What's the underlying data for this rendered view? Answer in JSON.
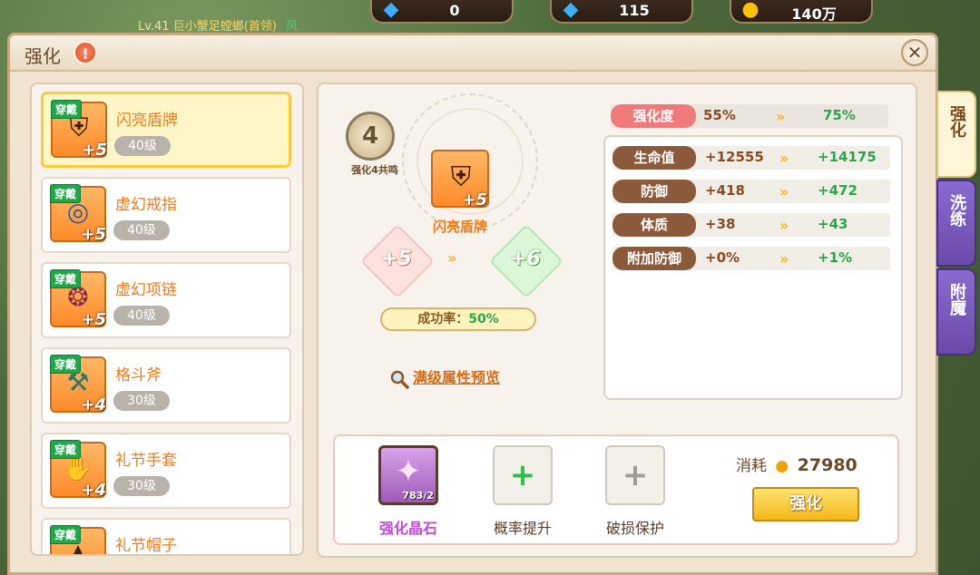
{
  "hud": {
    "level_text": "Lv.41",
    "player_name": "巨小蟹足螳螂(首领)",
    "zone_text": "风",
    "currencies": [
      {
        "icon": "diamond-icon",
        "value": "0"
      },
      {
        "icon": "bound-diamond-icon",
        "value": "115"
      },
      {
        "icon": "gold-icon",
        "value": "140万"
      }
    ]
  },
  "dialog": {
    "title": "强化",
    "help": "!",
    "close": "✕"
  },
  "items": [
    {
      "name": "闪亮盾牌",
      "level": "40级",
      "plus": "+5",
      "badge": "穿戴",
      "icon": "shield-icon",
      "selected": true
    },
    {
      "name": "虚幻戒指",
      "level": "40级",
      "plus": "+5",
      "badge": "穿戴",
      "icon": "ring-icon"
    },
    {
      "name": "虚幻项链",
      "level": "40级",
      "plus": "+5",
      "badge": "穿戴",
      "icon": "necklace-icon"
    },
    {
      "name": "格斗斧",
      "level": "30级",
      "plus": "+4",
      "badge": "穿戴",
      "icon": "axe-icon"
    },
    {
      "name": "礼节手套",
      "level": "30级",
      "plus": "+4",
      "badge": "穿戴",
      "icon": "glove-icon"
    },
    {
      "name": "礼节帽子",
      "level": "",
      "plus": "",
      "badge": "穿戴",
      "icon": "hat-icon"
    }
  ],
  "detail": {
    "medal_num": "4",
    "medal_caption": "强化4共鸣",
    "equip_name": "闪亮盾牌",
    "equip_plus": "+5",
    "current_plus": "+5",
    "next_plus": "+6",
    "arrow_glyph": "»",
    "rate_label": "成功率：",
    "rate_value": "50%",
    "preview_link": "满级属性预览",
    "strength": {
      "label": "强化度",
      "current": "55%",
      "next": "75%"
    },
    "stats": [
      {
        "label": "生命值",
        "current": "+12555",
        "next": "+14175"
      },
      {
        "label": "防御",
        "current": "+418",
        "next": "+472"
      },
      {
        "label": "体质",
        "current": "+38",
        "next": "+43"
      },
      {
        "label": "附加防御",
        "current": "+0%",
        "next": "+1%"
      }
    ],
    "materials": {
      "crystal_count": "783/2",
      "crystal_label": "强化晶石",
      "rate_label": "概率提升",
      "protect_label": "破损保护",
      "plus_glyph": "+"
    },
    "cost_label": "消耗",
    "cost_amount": "27980",
    "enhance_button": "强化"
  },
  "tabs": [
    {
      "label": "强化",
      "active": true
    },
    {
      "label": "洗练"
    },
    {
      "label": "附魔"
    }
  ],
  "colors": {
    "accent_orange": "#f07a18",
    "green_value": "#2aa64a",
    "stat_tag": "#8a5a3a",
    "strength_tag": "#f07a7a"
  }
}
